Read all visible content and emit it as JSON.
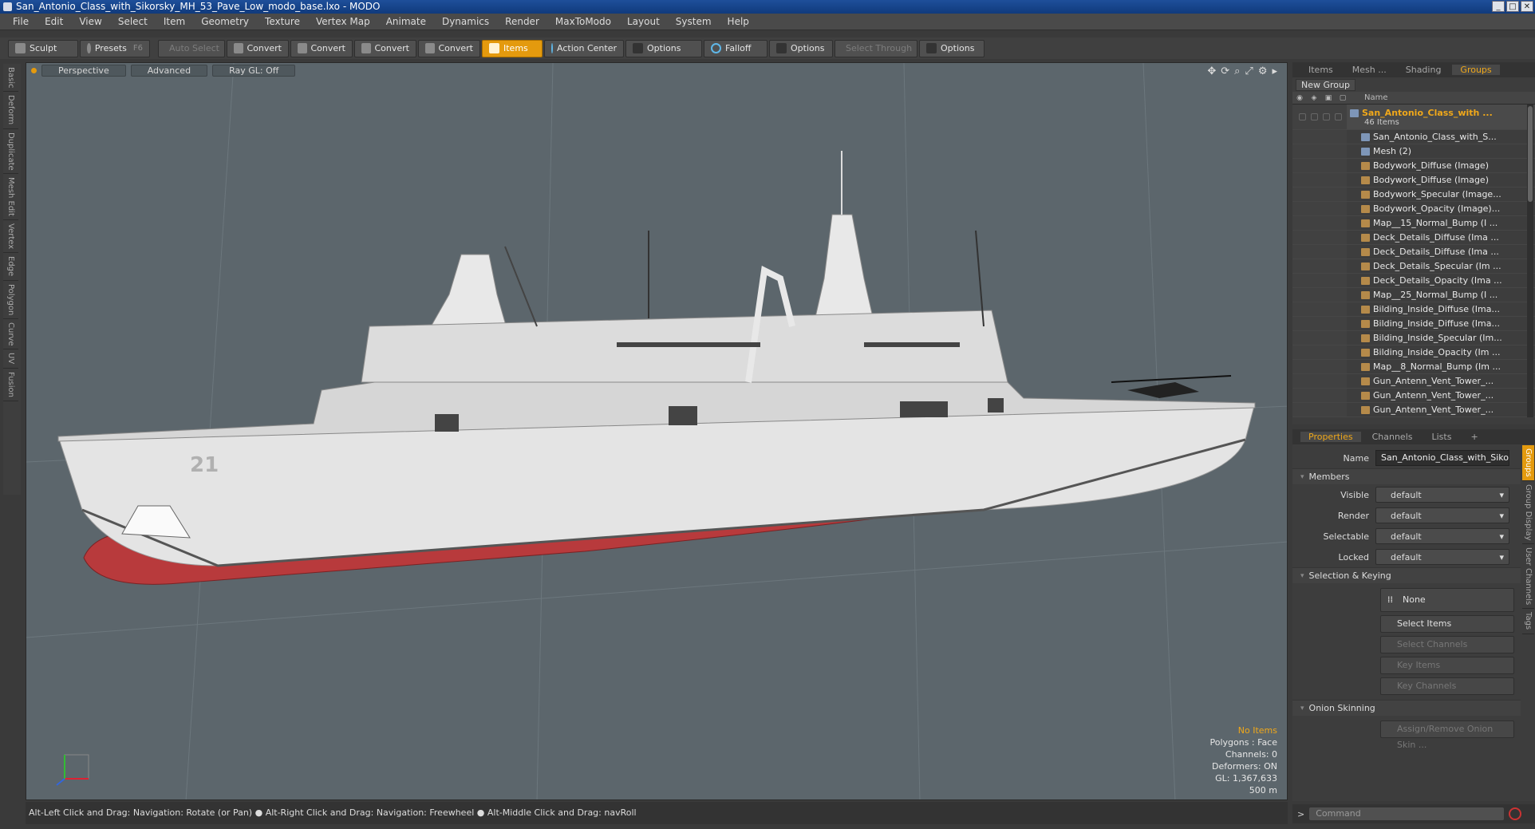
{
  "window": {
    "title": "San_Antonio_Class_with_Sikorsky_MH_53_Pave_Low_modo_base.lxo - MODO"
  },
  "menu": [
    "File",
    "Edit",
    "View",
    "Select",
    "Item",
    "Geometry",
    "Texture",
    "Vertex Map",
    "Animate",
    "Dynamics",
    "Render",
    "MaxToModo",
    "Layout",
    "System",
    "Help"
  ],
  "toolbar": {
    "sculpt": "Sculpt",
    "presets": "Presets",
    "presets_hotkey": "F6",
    "auto_select": "Auto Select",
    "convert": "Convert",
    "items": "Items",
    "action_center": "Action Center",
    "options": "Options",
    "falloff": "Falloff",
    "select_through": "Select Through"
  },
  "left_tabs": [
    "Basic",
    "Deform",
    "Duplicate",
    "Mesh Edit",
    "Vertex",
    "Edge",
    "Polygon",
    "Curve",
    "UV",
    "Fusion"
  ],
  "viewport": {
    "view": "Perspective",
    "shading": "Advanced",
    "raygl": "Ray GL: Off",
    "hull_number": "21",
    "info": {
      "no_items": "No Items",
      "polygons": "Polygons : Face",
      "channels": "Channels: 0",
      "deformers": "Deformers: ON",
      "gl": "GL: 1,367,633",
      "scale": "500 m"
    },
    "colors": {
      "background": "#5c666c",
      "hull": "#e4e4e4",
      "keel": "#b83a3c",
      "accent": "#e49a0e"
    }
  },
  "status_bar": "Alt-Left Click and Drag: Navigation: Rotate (or Pan) ● Alt-Right Click and Drag: Navigation: Freewheel ● Alt-Middle Click and Drag: navRoll",
  "groups_panel": {
    "tabs": [
      "Items",
      "Mesh ...",
      "Shading",
      "Groups"
    ],
    "new_group": "New Group",
    "name_col": "Name",
    "root_name": "San_Antonio_Class_with ...",
    "root_count": "46 Items",
    "children": [
      {
        "label": "San_Antonio_Class_with_S...",
        "kind": "mesh"
      },
      {
        "label": "Mesh (2)",
        "kind": "mesh"
      },
      {
        "label": "Bodywork_Diffuse (Image)",
        "kind": "img"
      },
      {
        "label": "Bodywork_Diffuse (Image)",
        "kind": "img"
      },
      {
        "label": "Bodywork_Specular (Image...",
        "kind": "img"
      },
      {
        "label": "Bodywork_Opacity (Image)...",
        "kind": "img"
      },
      {
        "label": "Map__15_Normal_Bump (I ...",
        "kind": "img"
      },
      {
        "label": "Deck_Details_Diffuse (Ima ...",
        "kind": "img"
      },
      {
        "label": "Deck_Details_Diffuse (Ima ...",
        "kind": "img"
      },
      {
        "label": "Deck_Details_Specular (Im ...",
        "kind": "img"
      },
      {
        "label": "Deck_Details_Opacity (Ima ...",
        "kind": "img"
      },
      {
        "label": "Map__25_Normal_Bump (I ...",
        "kind": "img"
      },
      {
        "label": "Bilding_Inside_Diffuse (Ima...",
        "kind": "img"
      },
      {
        "label": "Bilding_Inside_Diffuse (Ima...",
        "kind": "img"
      },
      {
        "label": "Bilding_Inside_Specular (Im...",
        "kind": "img"
      },
      {
        "label": "Bilding_Inside_Opacity (Im ...",
        "kind": "img"
      },
      {
        "label": "Map__8_Normal_Bump (Im ...",
        "kind": "img"
      },
      {
        "label": "Gun_Antenn_Vent_Tower_...",
        "kind": "img"
      },
      {
        "label": "Gun_Antenn_Vent_Tower_...",
        "kind": "img"
      },
      {
        "label": "Gun_Antenn_Vent_Tower_...",
        "kind": "img"
      }
    ]
  },
  "properties": {
    "tabs": [
      "Properties",
      "Channels",
      "Lists"
    ],
    "name_label": "Name",
    "name_value": "San_Antonio_Class_with_Sikorsk",
    "members": "Members",
    "visible_label": "Visible",
    "visible_value": "default",
    "render_label": "Render",
    "render_value": "default",
    "selectable_label": "Selectable",
    "selectable_value": "default",
    "locked_label": "Locked",
    "locked_value": "default",
    "sel_keying": "Selection & Keying",
    "none": "None",
    "select_items": "Select Items",
    "select_channels": "Select Channels",
    "key_items": "Key Items",
    "key_channels": "Key Channels",
    "onion": "Onion Skinning",
    "assign_onion": "Assign/Remove Onion Skin ...",
    "side_tabs": [
      "Groups",
      "Group Display",
      "User Channels",
      "Tags"
    ]
  },
  "command": {
    "placeholder": "Command"
  }
}
